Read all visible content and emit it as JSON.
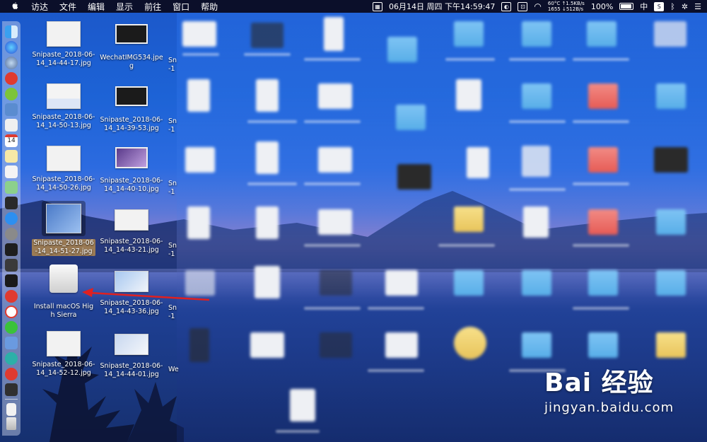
{
  "menubar": {
    "items": [
      "访达",
      "文件",
      "编辑",
      "显示",
      "前往",
      "窗口",
      "帮助"
    ],
    "date_text": "06月14日 周四 下午14:59:47",
    "cpu_temp": "60°C",
    "fan": "1655",
    "net_up": "↑1.5KB/s",
    "net_down": "↓512B/s",
    "battery": "100%",
    "input_method": "中"
  },
  "desktop": {
    "icons": [
      {
        "label": "Snipaste_2018-06-14_14-44-17.jpg"
      },
      {
        "label": "WechatIMG534.jpeg"
      },
      {
        "label": "Snipaste_2018-06-14_14-50-13.jpg"
      },
      {
        "label": "Snipaste_2018-06-14_14-39-53.jpg"
      },
      {
        "label": "Snipaste_2018-06-14_14-50-26.jpg"
      },
      {
        "label": "Snipaste_2018-06-14_14-40-10.jpg"
      },
      {
        "label": "Snipaste_2018-06-14_14-51-27.jpg"
      },
      {
        "label": "Snipaste_2018-06-14_14-43-21.jpg"
      },
      {
        "label": "Install macOS High Sierra"
      },
      {
        "label": "Snipaste_2018-06-14_14-43-36.jpg"
      },
      {
        "label": "Snipaste_2018-06-14_14-52-12.jpg"
      },
      {
        "label": "Snipaste_2018-06-14_14-44-01.jpg"
      }
    ],
    "partial_labels": [
      "Sn",
      "-1",
      "Sn",
      "-1",
      "Sn",
      "-1",
      "Sn",
      "-1",
      "Sn",
      "-1",
      "We"
    ]
  },
  "watermark": {
    "brand": "Bai 经验",
    "url": "jingyan.baidu.com"
  },
  "colors": {
    "menubar_bg": "#0b0f2a",
    "selection_label": "#9b7b55",
    "arrow": "#e02020"
  }
}
